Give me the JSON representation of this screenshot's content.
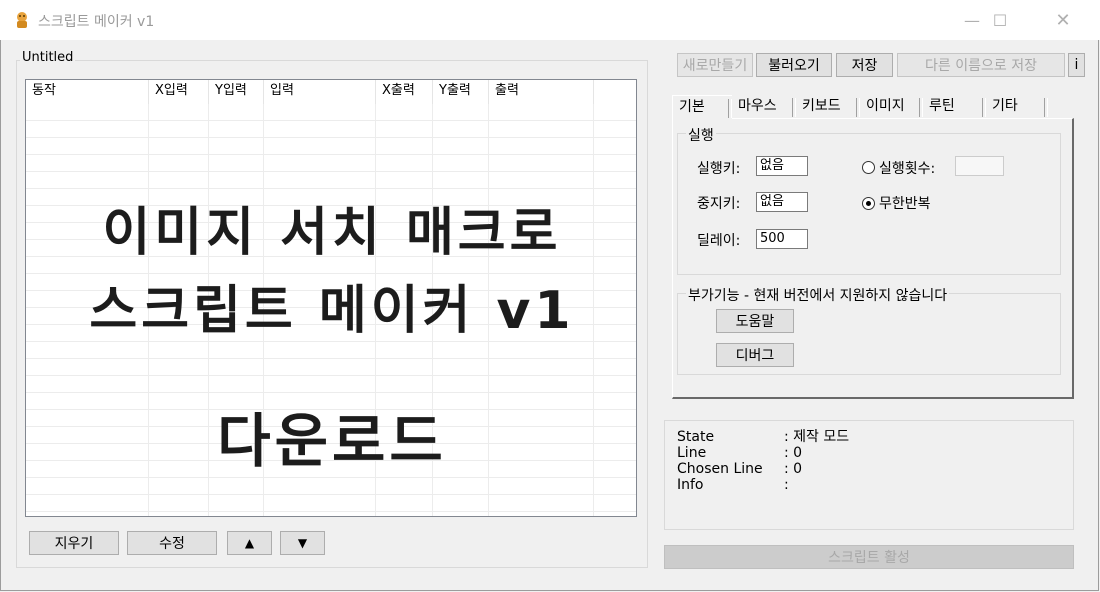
{
  "window": {
    "title": "스크립트 메이커 v1",
    "minimize": "—",
    "maximize": "☐",
    "close": "✕"
  },
  "left": {
    "group_title": "Untitled",
    "columns": [
      "동작",
      "X입력",
      "Y입력",
      "입력",
      "X출력",
      "Y출력",
      "출력"
    ],
    "overlay": {
      "line1": "이미지 서치 매크로",
      "line2": "스크립트 메이커 v1",
      "line3": "다운로드"
    },
    "buttons": {
      "delete": "지우기",
      "edit": "수정",
      "up": "▲",
      "down": "▼"
    }
  },
  "toolbar": {
    "new": "새로만들기",
    "open": "불러오기",
    "save": "저장",
    "save_as": "다른 이름으로 저장",
    "info": "i"
  },
  "tabs": [
    "기본",
    "마우스",
    "키보드",
    "이미지",
    "루틴",
    "기타"
  ],
  "basic": {
    "run_group": "실행",
    "run_key_label": "실행키:",
    "run_key_value": "없음",
    "stop_key_label": "중지키:",
    "stop_key_value": "없음",
    "delay_label": "딜레이:",
    "delay_value": "500",
    "run_count_label": "실행횟수:",
    "run_count_value": "",
    "infinite_label": "무한반복",
    "extra_group": "부가기능 - 현재 버전에서 지원하지 않습니다",
    "help_button": "도움말",
    "debug_button": "디버그"
  },
  "status": {
    "state_label": "State",
    "state_value": ": 제작 모드",
    "line_label": "Line",
    "line_value": ": 0",
    "chosen_label": "Chosen Line",
    "chosen_value": ": 0",
    "info_label": "Info",
    "info_value": ":"
  },
  "activate_button": "스크립트 활성"
}
